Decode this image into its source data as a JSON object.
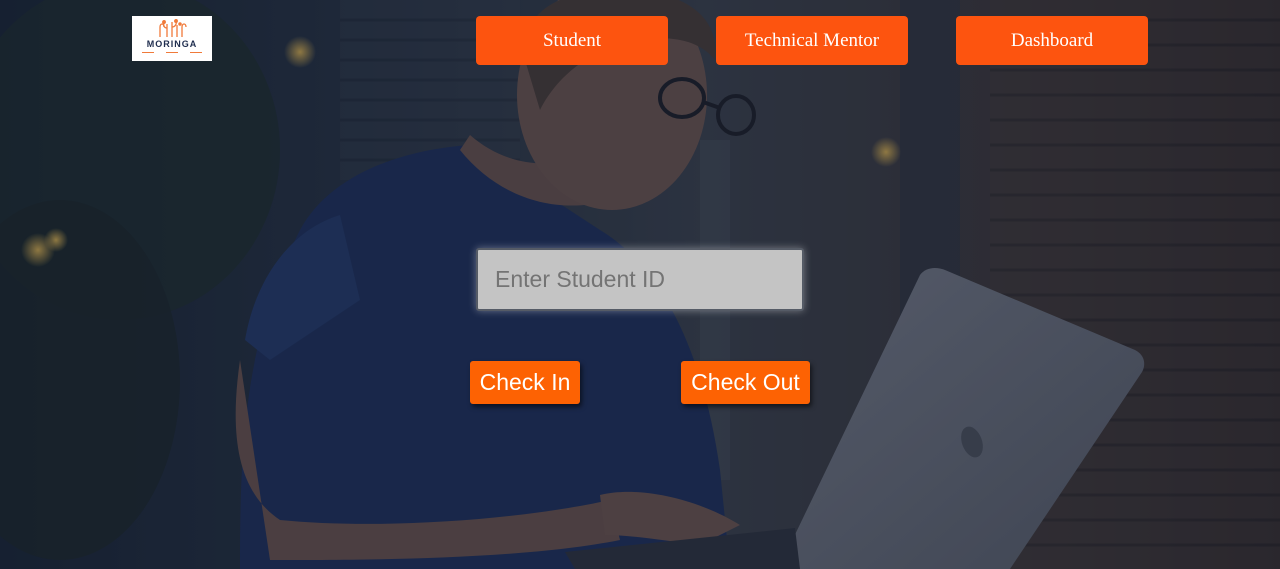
{
  "logo": {
    "text": "MORINGA",
    "icon": "moringa-logo-icon"
  },
  "nav": {
    "student_label": "Student",
    "mentor_label": "Technical Mentor",
    "dashboard_label": "Dashboard"
  },
  "checkin_form": {
    "student_id_placeholder": "Enter Student ID",
    "student_id_value": "",
    "checkin_label": "Check In",
    "checkout_label": "Check Out"
  },
  "colors": {
    "nav_button": "#fd540f",
    "action_button": "#fd6203",
    "input_background": "#c4c4c4",
    "overlay": "#1e2a3c"
  }
}
